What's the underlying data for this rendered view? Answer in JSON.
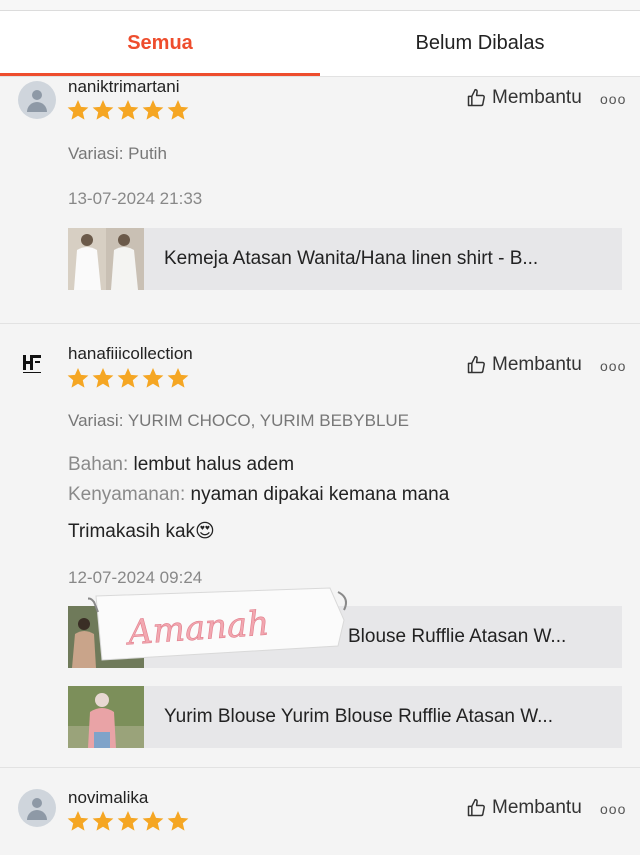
{
  "tabs": {
    "all": "Semua",
    "unreplied": "Belum Dibalas"
  },
  "helpful_label": "Membantu",
  "more_label": "ooo",
  "reviews": [
    {
      "username": "naniktrimartani",
      "rating": 5,
      "variation": "Variasi: Putih",
      "date": "13-07-2024 21:33",
      "products": [
        {
          "name": "Kemeja Atasan Wanita/Hana linen shirt - B..."
        }
      ]
    },
    {
      "username": "hanafiiicollection",
      "logo_text": "HF",
      "rating": 5,
      "variation": "Variasi: YURIM CHOCO, YURIM BEBYBLUE",
      "material_label": "Bahan:",
      "material_value": "lembut halus adem",
      "comfort_label": "Kenyamanan:",
      "comfort_value": "nyaman dipakai kemana mana",
      "comment": "Trimakasih kak",
      "comment_emoji": "😍",
      "date": "12-07-2024 09:24",
      "products": [
        {
          "name": "Blouse Rufflie Atasan W..."
        },
        {
          "name": "Yurim Blouse Yurim Blouse Rufflie Atasan W..."
        }
      ]
    },
    {
      "username": "novimalika",
      "rating": 5
    }
  ],
  "sticker": {
    "text": "Amanah"
  },
  "colors": {
    "accent": "#ee4d2d",
    "star": "#f5a623"
  }
}
